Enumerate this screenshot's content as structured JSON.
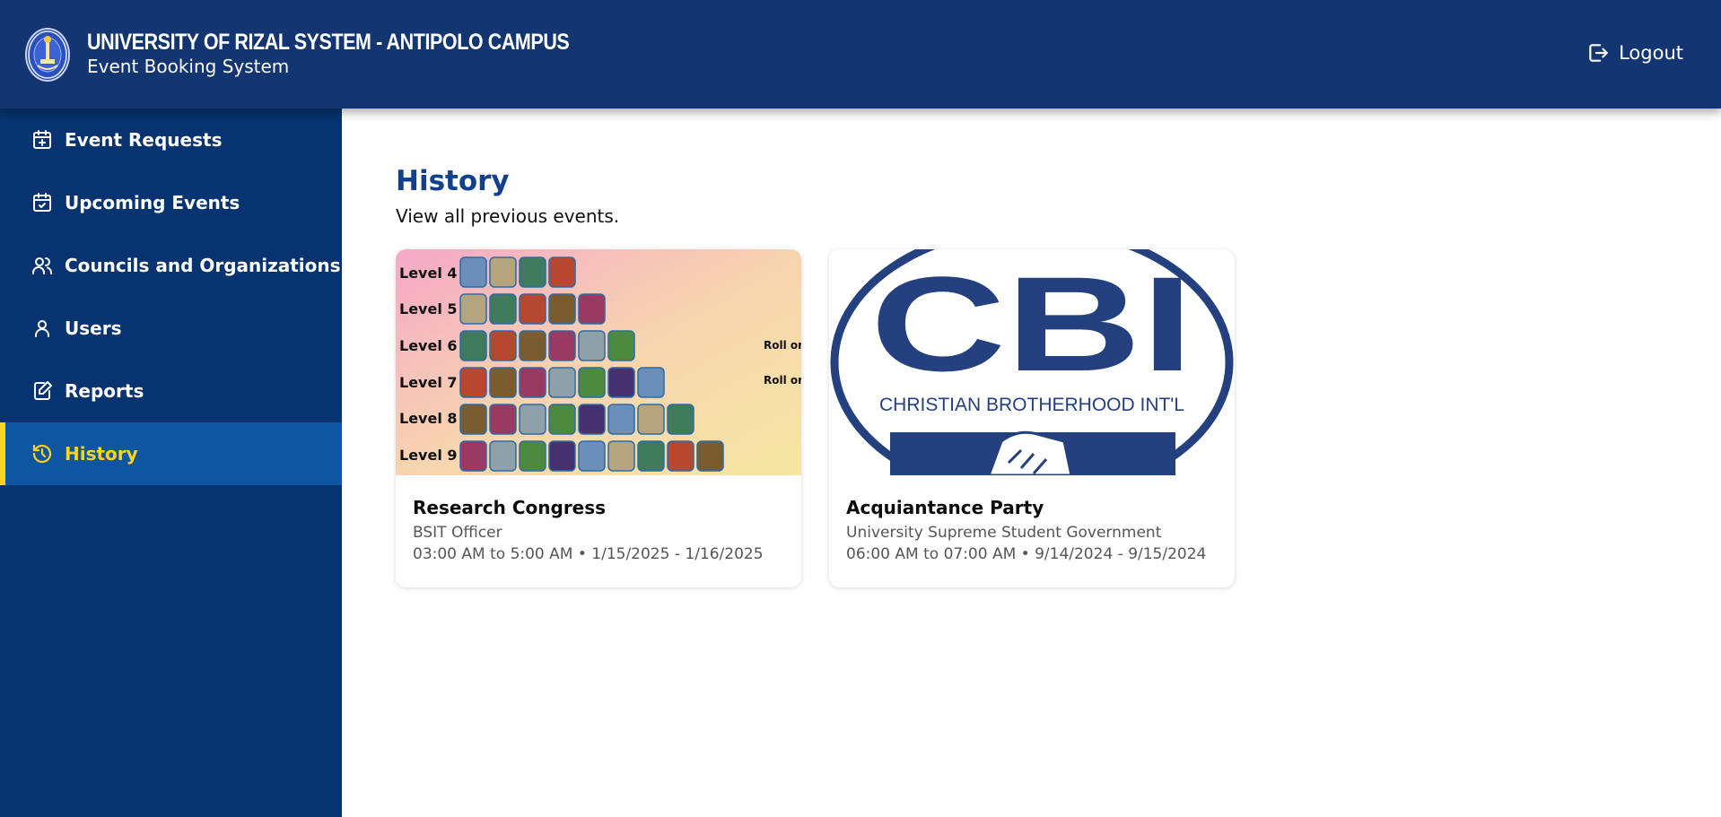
{
  "header": {
    "title": "UNIVERSITY OF RIZAL SYSTEM - ANTIPOLO CAMPUS",
    "subtitle": "Event Booking System",
    "logout_label": "Logout"
  },
  "sidebar": {
    "items": [
      {
        "label": "Event Requests",
        "icon": "calendar-plus-icon"
      },
      {
        "label": "Upcoming Events",
        "icon": "calendar-check-icon"
      },
      {
        "label": "Councils and Organizations",
        "icon": "users-icon"
      },
      {
        "label": "Users",
        "icon": "user-icon"
      },
      {
        "label": "Reports",
        "icon": "edit-document-icon"
      },
      {
        "label": "History",
        "icon": "history-icon",
        "active": true
      }
    ]
  },
  "main": {
    "title": "History",
    "subtitle": "View all previous events.",
    "cards": [
      {
        "title": "Research Congress",
        "organization": "BSIT Officer",
        "schedule": "03:00 AM to 5:00 AM • 1/15/2025 - 1/16/2025",
        "image": {
          "levels": [
            "Level 4",
            "Level 5",
            "Level 6",
            "Level 7",
            "Level 8",
            "Level 9"
          ],
          "side_text": "Roll or"
        }
      },
      {
        "title": "Acquiantance Party",
        "organization": "University Supreme Student Government",
        "schedule": "06:00 AM to 07:00 AM • 9/14/2024 - 9/15/2024",
        "image": {
          "logo_text": "CBI",
          "caption": "CHRISTIAN BROTHERHOOD INT'L"
        }
      }
    ]
  },
  "colors": {
    "header_bg": "#133673",
    "sidebar_bg": "#073470",
    "active_bg": "#0f56a0",
    "active_accent": "#ffd21f",
    "title_blue": "#12408f"
  }
}
